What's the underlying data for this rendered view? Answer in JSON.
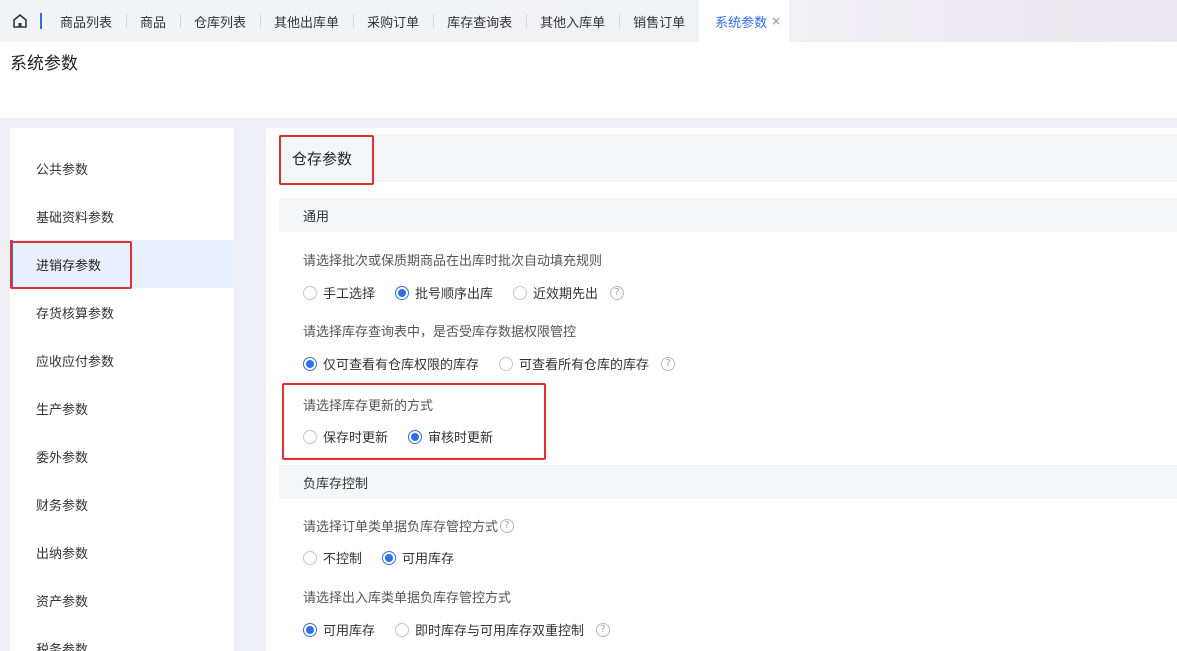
{
  "tabs": [
    {
      "label": "商品列表"
    },
    {
      "label": "商品"
    },
    {
      "label": "仓库列表"
    },
    {
      "label": "其他出库单"
    },
    {
      "label": "采购订单"
    },
    {
      "label": "库存查询表"
    },
    {
      "label": "其他入库单"
    },
    {
      "label": "销售订单"
    },
    {
      "label": "系统参数",
      "close": "×"
    }
  ],
  "page": {
    "title": "系统参数"
  },
  "sidebar": {
    "items": [
      {
        "label": "公共参数"
      },
      {
        "label": "基础资料参数"
      },
      {
        "label": "进销存参数"
      },
      {
        "label": "存货核算参数"
      },
      {
        "label": "应收应付参数"
      },
      {
        "label": "生产参数"
      },
      {
        "label": "委外参数"
      },
      {
        "label": "财务参数"
      },
      {
        "label": "出纳参数"
      },
      {
        "label": "资产参数"
      },
      {
        "label": "税务参数"
      }
    ]
  },
  "main": {
    "section_title": "仓存参数",
    "groups": [
      {
        "label": "通用"
      },
      {
        "label": "负库存控制"
      }
    ],
    "settings": [
      {
        "question": "请选择批次或保质期商品在出库时批次自动填充规则",
        "options": [
          "手工选择",
          "批号顺序出库",
          "近效期先出"
        ],
        "selected": "批号顺序出库"
      },
      {
        "question": "请选择库存查询表中，是否受库存数据权限管控",
        "options": [
          "仅可查看有仓库权限的库存",
          "可查看所有仓库的库存"
        ],
        "selected": "仅可查看有仓库权限的库存"
      },
      {
        "question": "请选择库存更新的方式",
        "options": [
          "保存时更新",
          "审核时更新"
        ],
        "selected": "审核时更新"
      },
      {
        "question": "请选择订单类单据负库存管控方式",
        "options": [
          "不控制",
          "可用库存"
        ],
        "selected": "可用库存"
      },
      {
        "question": "请选择出入库类单据负库存管控方式",
        "options": [
          "可用库存",
          "即时库存与可用库存双重控制"
        ],
        "selected": "可用库存"
      }
    ],
    "help_glyph": "?"
  },
  "colors": {
    "accent": "#2f6fe8",
    "highlight": "#e03131"
  }
}
